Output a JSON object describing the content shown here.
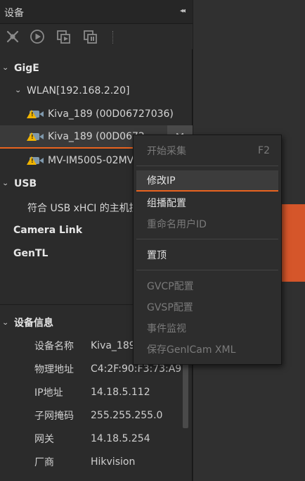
{
  "panel": {
    "title": "设备",
    "collapse_glyph": "◂◂"
  },
  "toolbar": {
    "buttons": [
      "disconnect-icon",
      "play-icon",
      "export-icon",
      "import-icon"
    ]
  },
  "tree": {
    "gige": "GigE",
    "wlan": "WLAN[192.168.2.20]",
    "devices": [
      "Kiva_189 (00D06727036)",
      "Kiva_189 (00D0672",
      "MV-IM5005-02MV"
    ],
    "usb": "USB",
    "usb_child": "符合 USB xHCI 的主机控",
    "cameralink": "Camera Link",
    "gentl": "GenTL"
  },
  "info": {
    "header": "设备信息",
    "rows": [
      {
        "k": "设备名称",
        "v": "Kiva_189"
      },
      {
        "k": "物理地址",
        "v": "C4:2F:90:F3:73:A9"
      },
      {
        "k": "IP地址",
        "v": "14.18.5.112"
      },
      {
        "k": "子网掩码",
        "v": "255.255.255.0"
      },
      {
        "k": "网关",
        "v": "14.18.5.254"
      },
      {
        "k": "厂商",
        "v": "Hikvision"
      }
    ]
  },
  "context_menu": {
    "start_capture": "开始采集",
    "start_capture_shortcut": "F2",
    "modify_ip": "修改IP",
    "multicast": "组播配置",
    "rename": "重命名用户ID",
    "pin_top": "置顶",
    "gvcp": "GVCP配置",
    "gvsp": "GVSP配置",
    "event_monitor": "事件监视",
    "save_genicam": "保存GenICam XML"
  },
  "colors": {
    "accent": "#e8631f",
    "warning": "#f0b400"
  }
}
